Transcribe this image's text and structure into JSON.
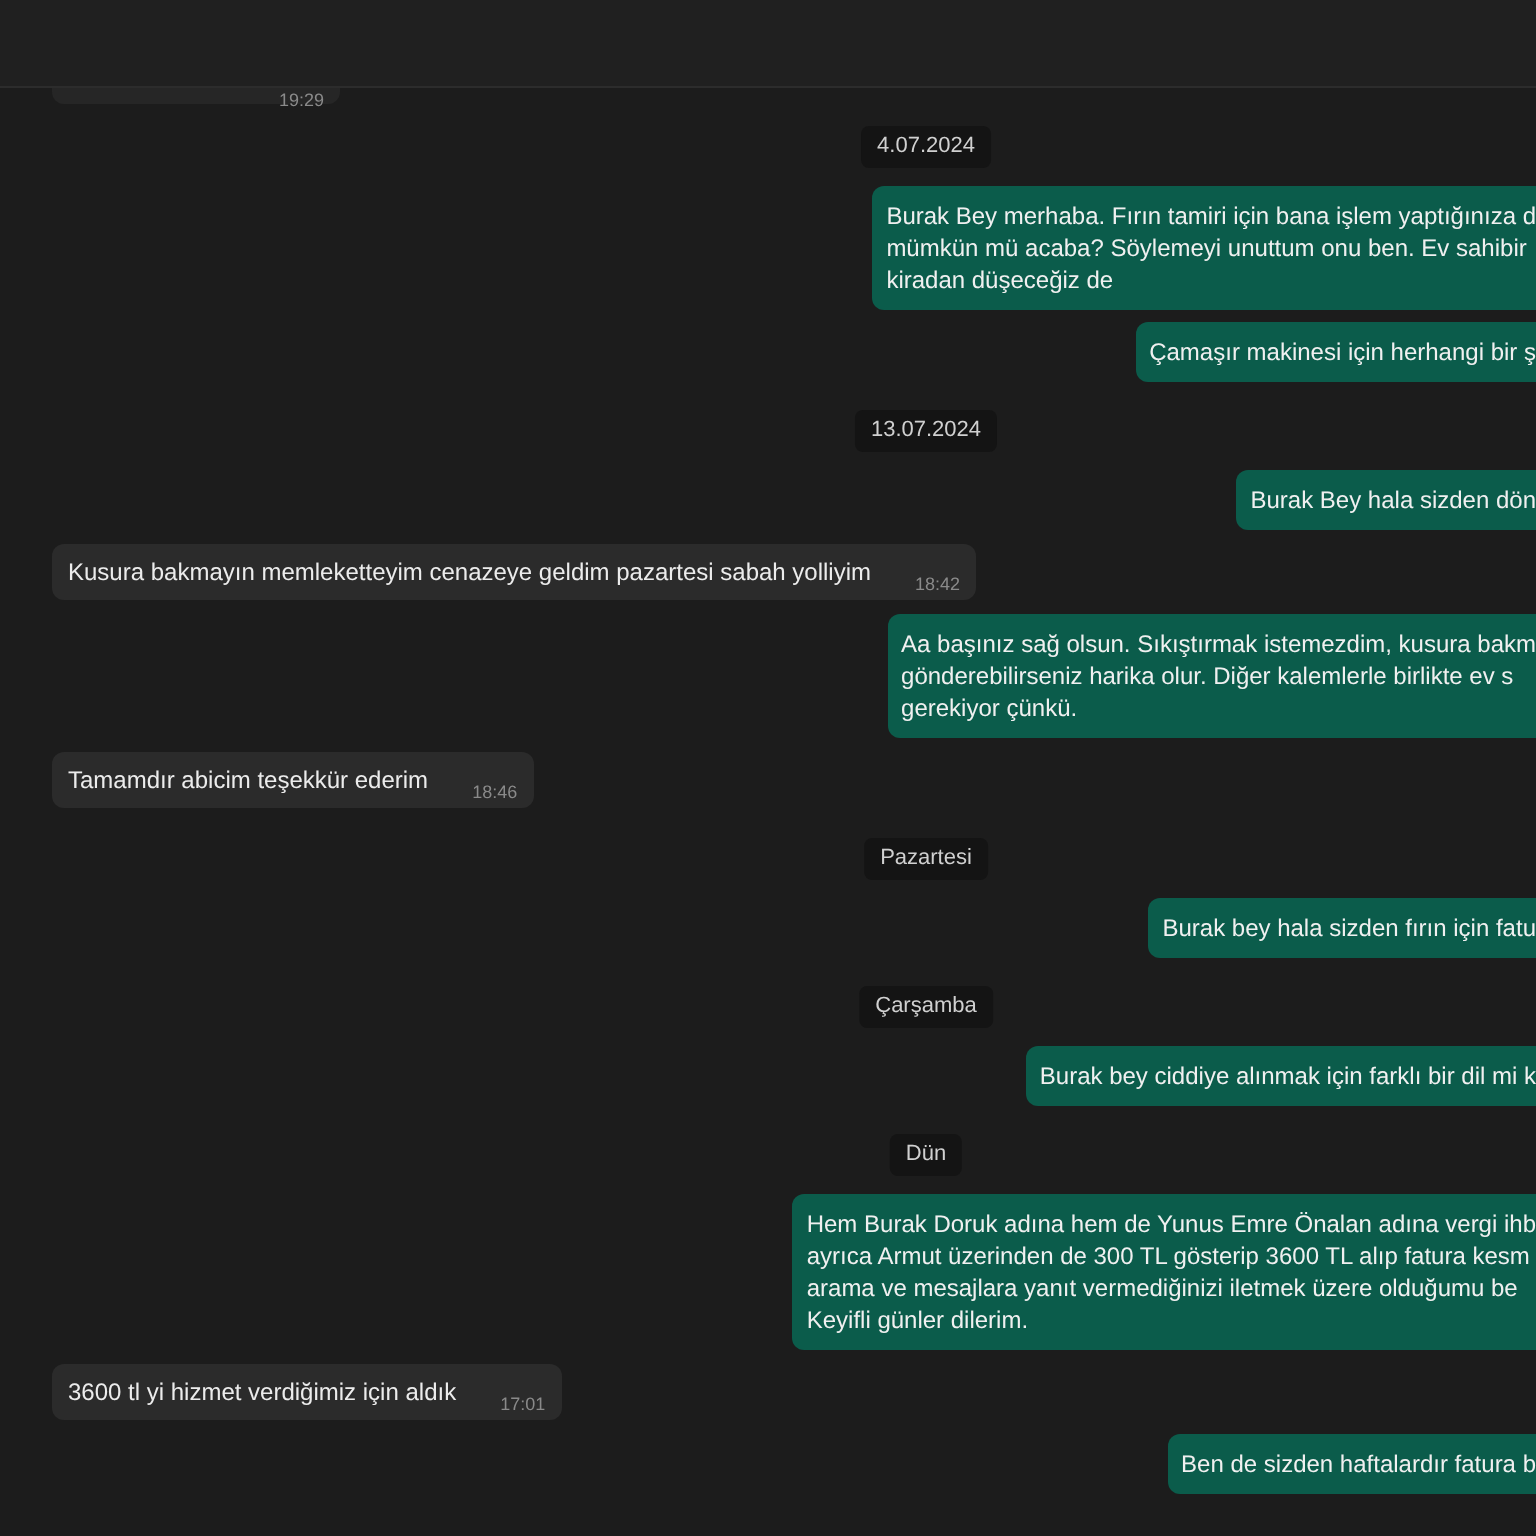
{
  "messages": [
    {
      "kind": "incoming",
      "time": "19:29"
    },
    {
      "kind": "date",
      "text": "4.07.2024"
    },
    {
      "kind": "outgoing",
      "text": "Burak Bey merhaba. Fırın tamiri için bana işlem yaptığınıza d\nmümkün mü acaba? Söylemeyi unuttum onu ben. Ev sahibir\nkiradan düşeceğiz de"
    },
    {
      "kind": "outgoing",
      "text": "Çamaşır makinesi için herhangi bir ş"
    },
    {
      "kind": "date",
      "text": "13.07.2024"
    },
    {
      "kind": "outgoing",
      "text": "Burak Bey hala sizden dön"
    },
    {
      "kind": "incoming",
      "text": "Kusura bakmayın memleketteyim cenazeye geldim pazartesi sabah yolliyim",
      "time": "18:42"
    },
    {
      "kind": "outgoing",
      "text": "Aa başınız sağ olsun. Sıkıştırmak istemezdim, kusura bakm\ngönderebilirseniz harika olur. Diğer kalemlerle birlikte ev s\ngerekiyor çünkü."
    },
    {
      "kind": "incoming",
      "text": "Tamamdır abicim teşekkür ederim",
      "time": "18:46"
    },
    {
      "kind": "date",
      "text": "Pazartesi"
    },
    {
      "kind": "outgoing",
      "text": "Burak bey hala sizden fırın için fatu"
    },
    {
      "kind": "date",
      "text": "Çarşamba"
    },
    {
      "kind": "outgoing",
      "text": "Burak bey ciddiye alınmak için farklı bir dil mi k"
    },
    {
      "kind": "date",
      "text": "Dün"
    },
    {
      "kind": "outgoing",
      "text": "Hem Burak Doruk adına hem de Yunus Emre Önalan adına vergi ihb\nayrıca Armut üzerinden de 300 TL gösterip 3600 TL alıp fatura kesm\narama ve mesajlara yanıt vermediğinizi iletmek üzere olduğumu be\nKeyifli günler dilerim."
    },
    {
      "kind": "incoming",
      "text": "3600 tl yi hizmet verdiğimiz için aldık",
      "time": "17:01"
    },
    {
      "kind": "outgoing",
      "text": "Ben de sizden haftalardır fatura b"
    }
  ]
}
